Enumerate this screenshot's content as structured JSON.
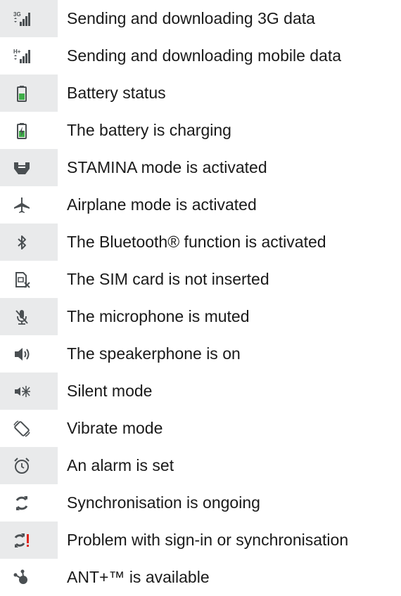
{
  "items": [
    {
      "icon": "signal-3g-icon",
      "label": "Sending and downloading 3G data"
    },
    {
      "icon": "signal-hplus-icon",
      "label": "Sending and downloading mobile data"
    },
    {
      "icon": "battery-icon",
      "label": "Battery status"
    },
    {
      "icon": "battery-charging-icon",
      "label": "The battery is charging"
    },
    {
      "icon": "stamina-icon",
      "label": "STAMINA mode is activated"
    },
    {
      "icon": "airplane-icon",
      "label": "Airplane mode is activated"
    },
    {
      "icon": "bluetooth-icon",
      "label": "The Bluetooth® function is activated"
    },
    {
      "icon": "sim-missing-icon",
      "label": "The SIM card is not inserted"
    },
    {
      "icon": "mic-muted-icon",
      "label": "The microphone is muted"
    },
    {
      "icon": "speakerphone-icon",
      "label": "The speakerphone is on"
    },
    {
      "icon": "silent-mode-icon",
      "label": "Silent mode"
    },
    {
      "icon": "vibrate-icon",
      "label": "Vibrate mode"
    },
    {
      "icon": "alarm-icon",
      "label": "An alarm is set"
    },
    {
      "icon": "sync-icon",
      "label": "Synchronisation is ongoing"
    },
    {
      "icon": "sync-problem-icon",
      "label": "Problem with sign-in or synchronisation"
    },
    {
      "icon": "ant-plus-icon",
      "label": "ANT+™ is available"
    }
  ],
  "colors": {
    "icon": "#4a4f52",
    "battery": "#3fae49",
    "warning": "#e0251b",
    "shade": "#e9eaeb"
  }
}
